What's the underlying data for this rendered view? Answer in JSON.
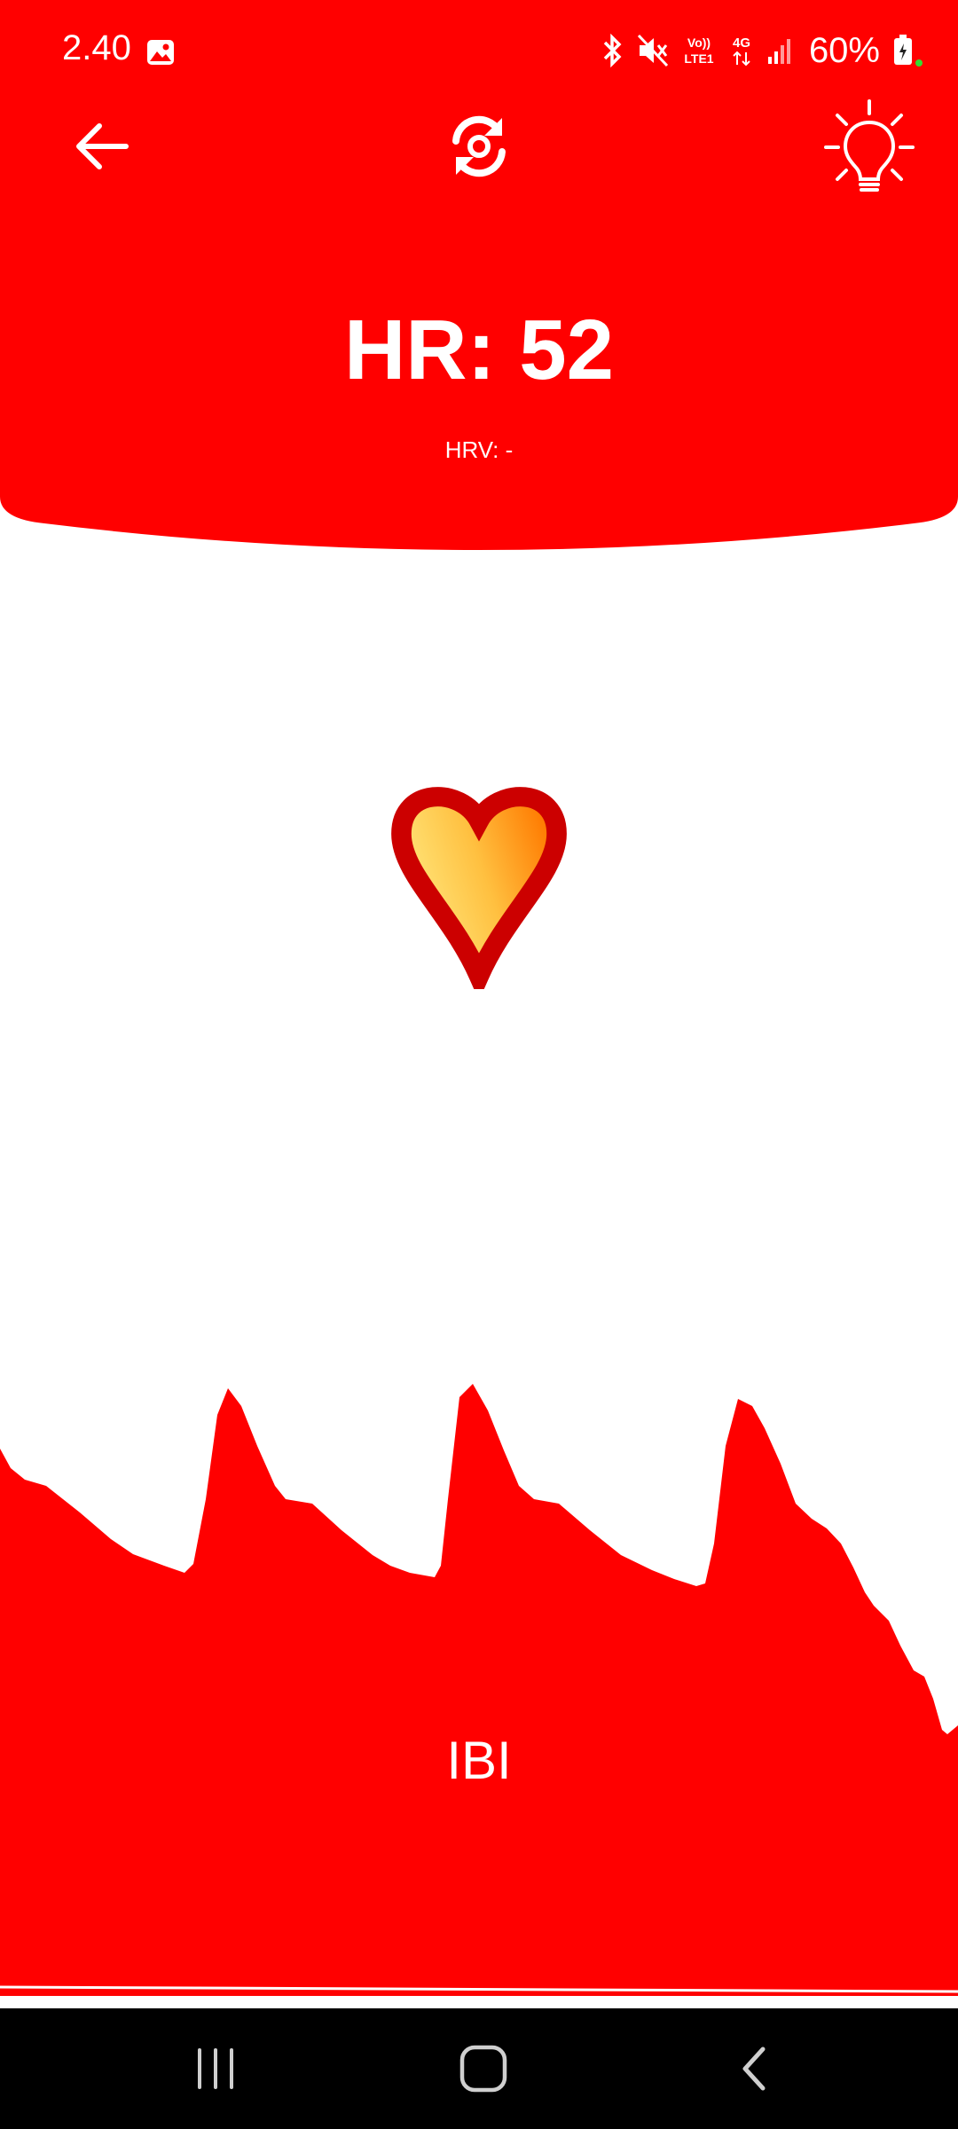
{
  "status_bar": {
    "time": "2.40",
    "battery": "60%",
    "network": "4G",
    "volte": "Vo)) LTE1"
  },
  "header": {
    "hr_text": "HR: 52",
    "hrv_text": "HRV: -",
    "background_color": "#ff0000"
  },
  "icons": {
    "back": "arrow-left-icon",
    "sync": "sync-icon",
    "light": "lightbulb-icon",
    "heart": "heart-icon"
  },
  "graph": {
    "label": "IBI",
    "fill_color": "#ff0000"
  },
  "nav": {
    "recent": "recent-apps-icon",
    "home": "home-icon",
    "back": "back-nav-icon"
  }
}
